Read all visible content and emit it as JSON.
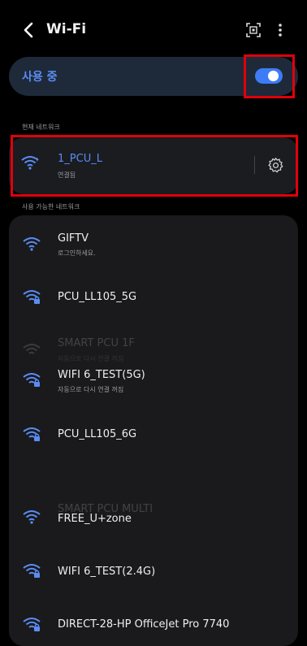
{
  "header": {
    "title": "Wi-Fi",
    "back_icon": "chevron-left-icon",
    "scan_icon": "qr-scan-icon",
    "more_icon": "more-vertical-icon"
  },
  "toggle": {
    "label": "사용 중",
    "state": "on",
    "accent": "#3d7cf5"
  },
  "current_network": {
    "section_label": "현재 네트워크",
    "name": "1_PCU_L",
    "status": "연결됨",
    "icon": "wifi-signal-icon",
    "settings_icon": "gear-icon"
  },
  "available": {
    "section_label": "사용 가능한 네트워크",
    "networks": [
      {
        "name": "GIFTV",
        "sub": "로그인하세요."
      },
      {
        "name": "PCU_LL105_5G",
        "sub": ""
      },
      {
        "name": "SMART PCU 1F",
        "sub": "자동으로 다시 연결 꺼짐"
      },
      {
        "name": "WIFI 6_TEST(5G)",
        "sub": "자동으로 다시 연결 꺼짐"
      },
      {
        "name": "PCU_LL105_6G",
        "sub": ""
      },
      {
        "name": "SMART PCU MULTI",
        "sub": ""
      },
      {
        "name": "FREE_U+zone",
        "sub": ""
      },
      {
        "name": "WIFI 6_TEST(2.4G)",
        "sub": ""
      },
      {
        "name": "DIRECT-28-HP OfficeJet Pro 7740",
        "sub": ""
      }
    ]
  },
  "colors": {
    "highlight": "#e0000b",
    "accent_text": "#5a8df3"
  }
}
